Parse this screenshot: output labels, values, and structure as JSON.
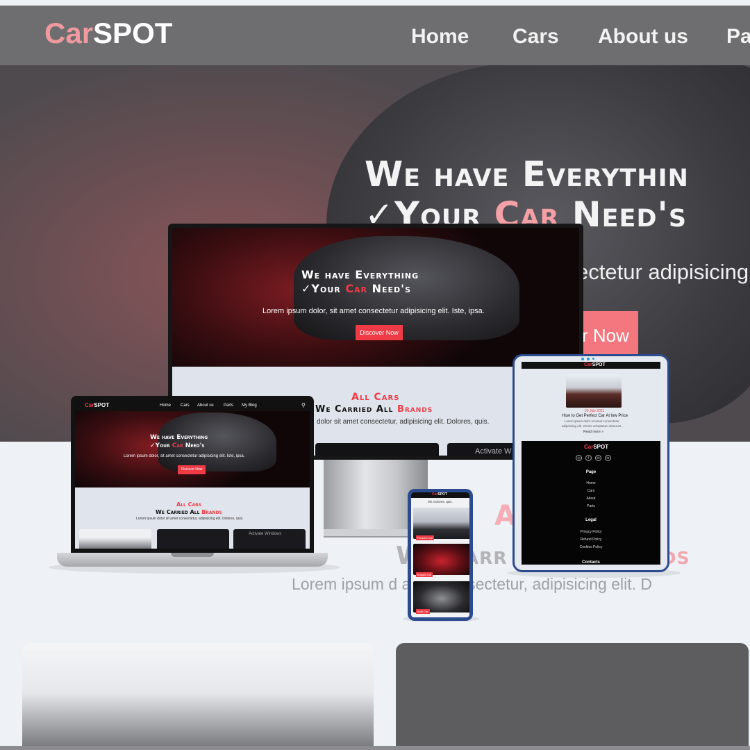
{
  "brand": {
    "part1": "Car",
    "part2": "SPOT"
  },
  "nav": [
    "Home",
    "Cars",
    "About us",
    "Pa"
  ],
  "bg": {
    "hero_title_line1": "We have Everythin",
    "hero_title_line2a": "Your ",
    "hero_title_car": "Car",
    "hero_title_line2b": " Need's",
    "hero_text": "ectetur adipisicing",
    "hero_button": "r Now",
    "section_title": "A",
    "section_subtitle_a": "We Carr",
    "section_subtitle_b": "ands",
    "section_text": "Lorem ipsum d           amet consectetur, adipisicing elit. D"
  },
  "monitor": {
    "title_line1": "We have Everything",
    "title_line2a": "Your ",
    "title_car": "Car",
    "title_line2b": " Need's",
    "text": "Lorem ipsum dolor, sit amet consectetur adipisicing elit. Iste, ipsa.",
    "button": "Discover Now",
    "section_title": "All Cars",
    "section_subtitle_a": "We Carried All ",
    "section_subtitle_b": "Brands",
    "section_text": "dolor sit amet consectetur, adipisicing elit. Dolores, quis.",
    "card_text": "Activate W"
  },
  "laptop": {
    "nav": [
      "Home",
      "Cars",
      "About us",
      "Parts",
      "My Blog"
    ],
    "title_line1": "We have Everything",
    "title_line2a": "Your ",
    "title_car": "Car",
    "title_line2b": " Need's",
    "text": "Lorem ipsum dolor, sit amet consectetur adipisicing elit. Iste, ipsa.",
    "button": "Discover Now",
    "section_title": "All Cars",
    "section_subtitle_a": "We Carried All ",
    "section_subtitle_b": "Brands",
    "section_text": "Lorem ipsum dolor sit amet consectetur, adipisicing elit. Dolores, quis.",
    "card_text": "Activate Windows"
  },
  "tablet": {
    "post_date": "20 July 2021",
    "post_title": "How to Get Perfect Car At low Price",
    "post_text1": "Lorem ipsum dolor sit amet consectetur",
    "post_text2": "adipisicing elit. Omnis voluptatum deserunt .",
    "read_more": "Read more »",
    "social": [
      "◎",
      "f",
      "✉",
      "in"
    ],
    "page_heading": "Page",
    "page_links": [
      "Home",
      "Cars",
      "About",
      "Parts"
    ],
    "legal_heading": "Legal",
    "legal_links": [
      "Privacy Policy",
      "Refund Policy",
      "Cookies Policy"
    ],
    "contacts_heading": "Contacts"
  },
  "phone": {
    "caption": "elit. Dolores, quis.",
    "labels": [
      "Porsche Car",
      "Bugatti Car",
      "Audi Car"
    ]
  }
}
